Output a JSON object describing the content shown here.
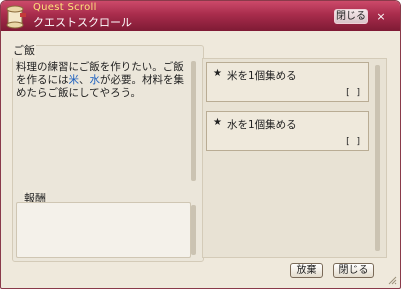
{
  "window": {
    "title_en": "Quest Scroll",
    "title_jp": "クエストスクロール",
    "close_label": "閉じる",
    "x_label": "×"
  },
  "quest": {
    "name": "ご飯",
    "description_parts": [
      "料理の練習にご飯を作りたい。ご飯を作るには",
      "米",
      "、",
      "水",
      "が必要。材料を集めたらご飯にしてやろう。"
    ],
    "reward_title": "報酬"
  },
  "objectives": [
    {
      "star": "★",
      "label": "米を1個集める",
      "progress": "[ ]"
    },
    {
      "star": "★",
      "label": "水を1個集める",
      "progress": "[ ]"
    }
  ],
  "footer": {
    "quit_label": "放棄",
    "close_label": "閉じる"
  },
  "colors": {
    "titlebar": "#a82c4c",
    "highlight": "#1b5fbf",
    "title_en": "#ffe27a"
  }
}
